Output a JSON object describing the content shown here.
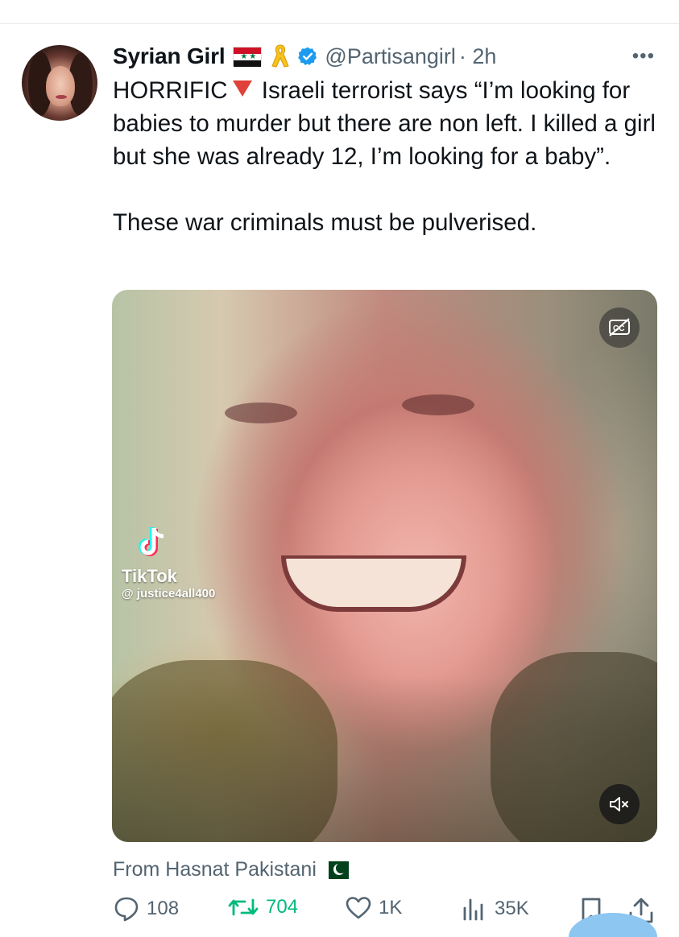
{
  "tweet": {
    "author": {
      "display_name": "Syrian Girl",
      "handle": "@Partisangirl",
      "time": "· 2h",
      "verified": true
    },
    "more_label": "•••",
    "text_before_icon": "HORRIFIC",
    "text_after_icon": " Israeli terrorist says “I’m looking for babies to murder but there are non left. I killed a girl but she was already 12, I’m looking for a baby”.\n\nThese war criminals must be pulverised.",
    "media": {
      "type": "video",
      "watermark_brand": "TikTok",
      "watermark_user": "@ justice4all400",
      "captions_icon": "closed-captions-icon",
      "mute_icon": "volume-muted-icon"
    },
    "from_label": "From Hasnat Pakistani",
    "stats": {
      "replies": "108",
      "retweets": "704",
      "likes": "1K",
      "views": "35K"
    }
  },
  "colors": {
    "text": "#0f1419",
    "muted": "#536471",
    "retweet": "#00ba7c",
    "verified": "#1d9bf0",
    "accent_blue": "#8ec6f2"
  }
}
